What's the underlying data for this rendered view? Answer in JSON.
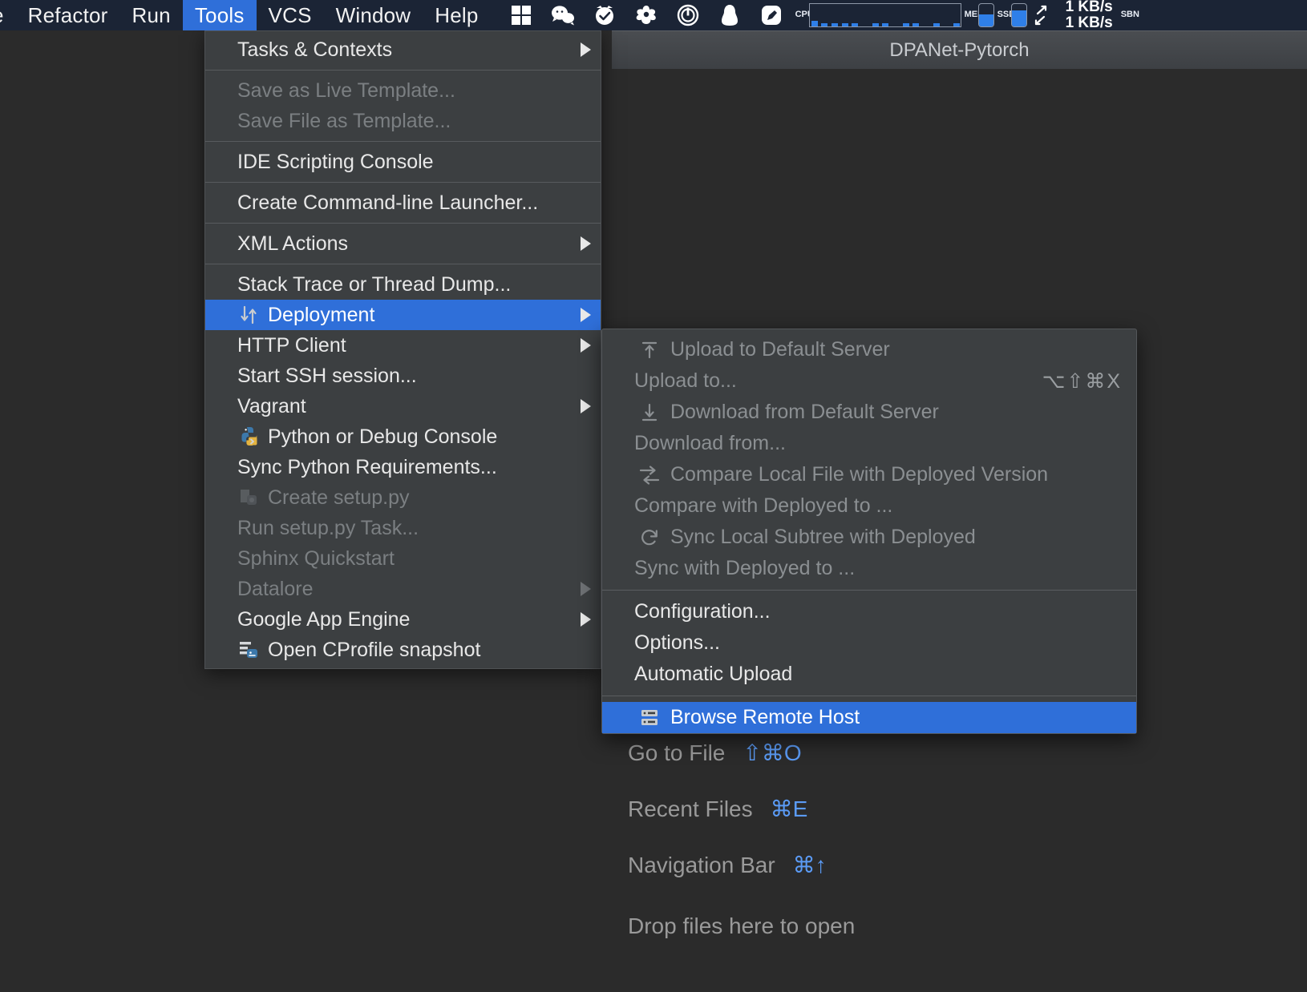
{
  "menubar": {
    "items": [
      {
        "label": "e",
        "active": false
      },
      {
        "label": "Refactor",
        "active": false
      },
      {
        "label": "Run",
        "active": false
      },
      {
        "label": "Tools",
        "active": true
      },
      {
        "label": "VCS",
        "active": false
      },
      {
        "label": "Window",
        "active": false
      },
      {
        "label": "Help",
        "active": false
      }
    ],
    "tray_icons": [
      "windows-grid-icon",
      "wechat-icon",
      "alarm-check-icon",
      "aria2-icon",
      "power-circle-icon",
      "qq-penguin-icon",
      "pen-nib-icon"
    ],
    "cpu_label": "CPU",
    "mem_label": "MEM",
    "ssd_label": "SSD",
    "net_up": "1 KB/s",
    "net_down": "1 KB/s",
    "edge_label": "SBN",
    "mem_fill_pct": 55,
    "ssd_fill_pct": 72,
    "cpu_samples": [
      8,
      4,
      4,
      4,
      4,
      0,
      4,
      4,
      0,
      4,
      4,
      0,
      4,
      0,
      4
    ]
  },
  "window": {
    "title": "DPANet-Pytorch"
  },
  "welcome": {
    "rows": [
      {
        "label": "Go to File",
        "shortcut": "⇧⌘O"
      },
      {
        "label": "Recent Files",
        "shortcut": "⌘E"
      },
      {
        "label": "Navigation Bar",
        "shortcut": "⌘↑"
      }
    ],
    "drop_text": "Drop files here to open"
  },
  "tools_menu": {
    "groups": [
      {
        "items": [
          {
            "label": "Tasks & Contexts",
            "disabled": false,
            "submenu": true,
            "icon": null,
            "selected": false
          }
        ]
      },
      {
        "items": [
          {
            "label": "Save as Live Template...",
            "disabled": true,
            "submenu": false,
            "icon": null,
            "selected": false
          },
          {
            "label": "Save File as Template...",
            "disabled": true,
            "submenu": false,
            "icon": null,
            "selected": false
          }
        ]
      },
      {
        "items": [
          {
            "label": "IDE Scripting Console",
            "disabled": false,
            "submenu": false,
            "icon": null,
            "selected": false
          }
        ]
      },
      {
        "items": [
          {
            "label": "Create Command-line Launcher...",
            "disabled": false,
            "submenu": false,
            "icon": null,
            "selected": false
          }
        ]
      },
      {
        "items": [
          {
            "label": "XML Actions",
            "disabled": false,
            "submenu": true,
            "icon": null,
            "selected": false
          }
        ]
      },
      {
        "items": [
          {
            "label": "Stack Trace or Thread Dump...",
            "disabled": false,
            "submenu": false,
            "icon": null,
            "selected": false
          },
          {
            "label": "Deployment",
            "disabled": false,
            "submenu": true,
            "icon": "deployment-arrows-icon",
            "selected": true
          },
          {
            "label": "HTTP Client",
            "disabled": false,
            "submenu": true,
            "icon": null,
            "selected": false
          },
          {
            "label": "Start SSH session...",
            "disabled": false,
            "submenu": false,
            "icon": null,
            "selected": false
          },
          {
            "label": "Vagrant",
            "disabled": false,
            "submenu": true,
            "icon": null,
            "selected": false
          },
          {
            "label": "Python or Debug Console",
            "disabled": false,
            "submenu": false,
            "icon": "python-console-icon",
            "selected": false
          },
          {
            "label": "Sync Python Requirements...",
            "disabled": false,
            "submenu": false,
            "icon": null,
            "selected": false
          },
          {
            "label": "Create setup.py",
            "disabled": true,
            "submenu": false,
            "icon": "setup-py-icon",
            "selected": false
          },
          {
            "label": "Run setup.py Task...",
            "disabled": true,
            "submenu": false,
            "icon": null,
            "selected": false
          },
          {
            "label": "Sphinx Quickstart",
            "disabled": true,
            "submenu": false,
            "icon": null,
            "selected": false
          },
          {
            "label": "Datalore",
            "disabled": true,
            "submenu": true,
            "icon": null,
            "selected": false
          },
          {
            "label": "Google App Engine",
            "disabled": false,
            "submenu": true,
            "icon": null,
            "selected": false
          },
          {
            "label": "Open CProfile snapshot",
            "disabled": false,
            "submenu": false,
            "icon": "cprofile-icon",
            "selected": false
          }
        ]
      }
    ]
  },
  "deployment_submenu": {
    "groups": [
      {
        "items": [
          {
            "label": "Upload to Default Server",
            "disabled": true,
            "icon": "upload-icon",
            "shortcut": "",
            "selected": false
          },
          {
            "label": "Upload to...",
            "disabled": true,
            "icon": null,
            "shortcut": "⌥⇧⌘X",
            "selected": false
          },
          {
            "label": "Download from Default Server",
            "disabled": true,
            "icon": "download-icon",
            "shortcut": "",
            "selected": false
          },
          {
            "label": "Download from...",
            "disabled": true,
            "icon": null,
            "shortcut": "",
            "selected": false
          },
          {
            "label": "Compare Local File with Deployed Version",
            "disabled": true,
            "icon": "compare-icon",
            "shortcut": "",
            "selected": false
          },
          {
            "label": "Compare with Deployed to ...",
            "disabled": true,
            "icon": null,
            "shortcut": "",
            "selected": false
          },
          {
            "label": "Sync Local Subtree with Deployed",
            "disabled": true,
            "icon": "sync-icon",
            "shortcut": "",
            "selected": false
          },
          {
            "label": "Sync with Deployed to ...",
            "disabled": true,
            "icon": null,
            "shortcut": "",
            "selected": false
          }
        ]
      },
      {
        "items": [
          {
            "label": "Configuration...",
            "disabled": false,
            "icon": null,
            "shortcut": "",
            "selected": false
          },
          {
            "label": "Options...",
            "disabled": false,
            "icon": null,
            "shortcut": "",
            "selected": false
          },
          {
            "label": "Automatic Upload",
            "disabled": false,
            "icon": null,
            "shortcut": "",
            "selected": false
          }
        ]
      },
      {
        "items": [
          {
            "label": "Browse Remote Host",
            "disabled": false,
            "icon": "server-icon",
            "shortcut": "",
            "selected": true
          }
        ]
      }
    ]
  },
  "colors": {
    "accent": "#2f6fd9",
    "menu_bg": "#3c3f41",
    "menubar_bg": "#1b2435",
    "ide_bg": "#2b2b2b",
    "shortcut_blue": "#5b9bf5"
  }
}
